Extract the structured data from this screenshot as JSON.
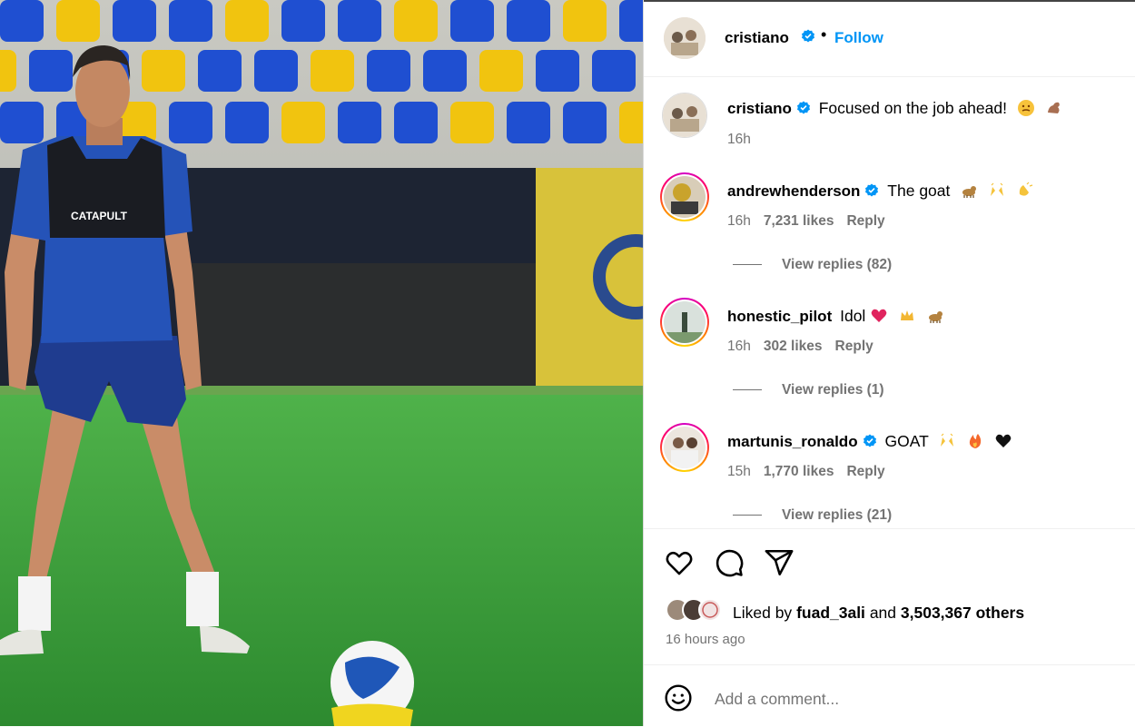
{
  "post": {
    "author": "cristiano",
    "follow_label": "Follow",
    "caption": "Focused on the job ahead!",
    "caption_time": "16h"
  },
  "media": {
    "vest_text": "CATAPULT"
  },
  "comments": [
    {
      "username": "andrewhenderson",
      "verified": true,
      "text": "The goat",
      "time": "16h",
      "likes": "7,231 likes",
      "reply_label": "Reply",
      "view_replies": "View replies (82)",
      "emojis": [
        "goat-icon",
        "raising-hands-icon",
        "clapping-hands-icon"
      ]
    },
    {
      "username": "honestic_pilot",
      "verified": false,
      "text": "Idol",
      "time": "16h",
      "likes": "302 likes",
      "reply_label": "Reply",
      "view_replies": "View replies (1)",
      "emojis": [
        "heart-icon",
        "crown-icon",
        "goat-icon"
      ]
    },
    {
      "username": "martunis_ronaldo",
      "verified": true,
      "text": "GOAT",
      "time": "15h",
      "likes": "1,770 likes",
      "reply_label": "Reply",
      "view_replies": "View replies (21)",
      "emojis": [
        "raising-hands-icon",
        "fire-icon",
        "black-heart-icon"
      ]
    }
  ],
  "likes": {
    "prefix": "Liked by",
    "user": "fuad_3ali",
    "connector": "and",
    "others": "3,503,367 others"
  },
  "timestamp": "16 hours ago",
  "comment_input": {
    "placeholder": "Add a comment..."
  },
  "colors": {
    "accent": "#0095f6",
    "verified": "#0095f6",
    "secondary_text": "#737373"
  }
}
